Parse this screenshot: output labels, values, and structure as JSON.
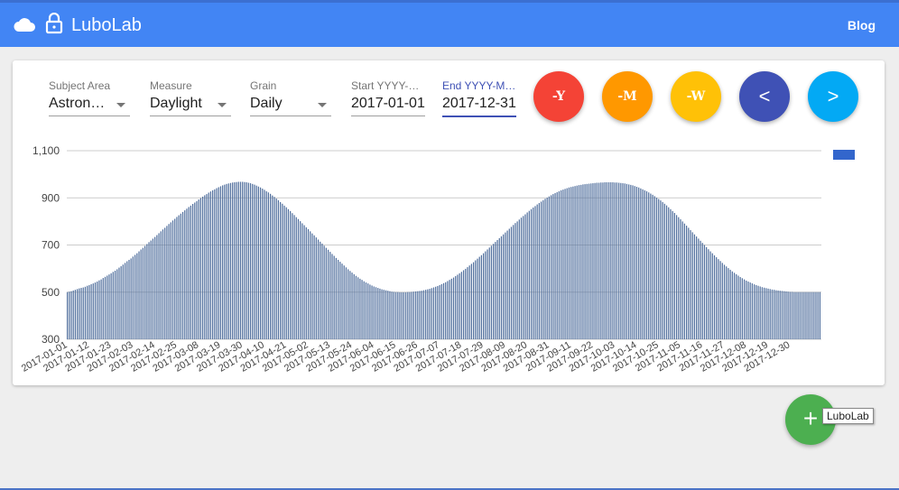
{
  "header": {
    "brand": "LuboLab",
    "blog_link": "Blog",
    "icons": [
      "cloud-icon",
      "lock-icon"
    ],
    "color": "#4285f4"
  },
  "filters": {
    "subject_area": {
      "label": "Subject Area",
      "value": "Astrono..."
    },
    "measure": {
      "label": "Measure",
      "value": "Daylight"
    },
    "grain": {
      "label": "Grain",
      "value": "Daily"
    },
    "start": {
      "label": "Start YYYY-M...",
      "value": "2017-01-01"
    },
    "end": {
      "label": "End YYYY-MM...",
      "value": "2017-12-31"
    }
  },
  "buttons": {
    "minus_year": {
      "label": "-Y",
      "color": "#f44336"
    },
    "minus_month": {
      "label": "-M",
      "color": "#ff9800"
    },
    "minus_week": {
      "label": "-W",
      "color": "#ffc107"
    },
    "prev": {
      "label": "<",
      "color": "#3f51b5"
    },
    "next": {
      "label": ">",
      "color": "#03a9f4"
    },
    "add": {
      "label": "+",
      "color": "#4caf50"
    }
  },
  "tooltip": "LuboLab",
  "chart_data": {
    "type": "bar",
    "title": "",
    "xlabel": "",
    "ylabel": "",
    "ylim": [
      300,
      1100
    ],
    "yticks": [
      "300",
      "500",
      "700",
      "900",
      "1,100"
    ],
    "grid": true,
    "legend": "top-right",
    "series_color": "#4e6d9c",
    "legend_color": "#3366cc",
    "x_start": "2017-01-01",
    "x_end": "2017-12-31",
    "x_tick_labels": [
      "2017-01-01",
      "2017-01-12",
      "2017-01-23",
      "2017-02-03",
      "2017-02-14",
      "2017-02-25",
      "2017-03-08",
      "2017-03-19",
      "2017-03-30",
      "2017-04-10",
      "2017-04-21",
      "2017-05-02",
      "2017-05-13",
      "2017-05-24",
      "2017-06-04",
      "2017-06-15",
      "2017-06-26",
      "2017-07-07",
      "2017-07-18",
      "2017-07-29",
      "2017-08-09",
      "2017-08-20",
      "2017-08-31",
      "2017-09-11",
      "2017-09-22",
      "2017-10-03",
      "2017-10-14",
      "2017-10-25",
      "2017-11-05",
      "2017-11-16",
      "2017-11-27",
      "2017-12-08",
      "2017-12-19",
      "2017-12-30"
    ],
    "values": [
      500,
      502,
      504,
      507,
      510,
      513,
      516,
      518,
      520,
      523,
      527,
      530,
      534,
      537,
      541,
      545,
      550,
      554,
      560,
      565,
      570,
      575,
      580,
      586,
      591,
      597,
      604,
      610,
      617,
      624,
      631,
      637,
      643,
      651,
      658,
      665,
      673,
      681,
      688,
      696,
      704,
      712,
      719,
      727,
      734,
      742,
      750,
      758,
      766,
      773,
      781,
      789,
      796,
      804,
      811,
      819,
      826,
      833,
      840,
      847,
      854,
      861,
      867,
      874,
      880,
      886,
      893,
      899,
      905,
      911,
      916,
      922,
      927,
      932,
      936,
      941,
      945,
      949,
      953,
      956,
      959,
      961,
      963,
      965,
      966,
      967,
      968,
      968,
      968,
      967,
      966,
      964,
      962,
      959,
      956,
      952,
      948,
      944,
      939,
      934,
      928,
      923,
      917,
      910,
      904,
      897,
      890,
      882,
      875,
      867,
      860,
      852,
      844,
      835,
      827,
      818,
      810,
      801,
      792,
      784,
      775,
      767,
      758,
      749,
      741,
      732,
      723,
      714,
      706,
      697,
      688,
      680,
      671,
      662,
      654,
      645,
      637,
      629,
      621,
      613,
      605,
      597,
      590,
      583,
      576,
      569,
      563,
      557,
      552,
      546,
      541,
      537,
      532,
      528,
      524,
      521,
      518,
      515,
      512,
      510,
      508,
      506,
      504,
      502,
      501,
      500,
      500,
      499,
      499,
      499,
      499,
      500,
      500,
      501,
      502,
      503,
      504,
      505,
      506,
      508,
      510,
      512,
      514,
      517,
      520,
      523,
      526,
      530,
      534,
      538,
      542,
      547,
      552,
      557,
      562,
      568,
      574,
      580,
      586,
      593,
      599,
      606,
      613,
      620,
      627,
      635,
      642,
      650,
      657,
      665,
      673,
      681,
      689,
      697,
      705,
      713,
      721,
      729,
      737,
      745,
      753,
      761,
      769,
      777,
      785,
      793,
      800,
      808,
      816,
      823,
      830,
      838,
      845,
      852,
      859,
      865,
      872,
      878,
      884,
      890,
      896,
      901,
      906,
      911,
      916,
      920,
      924,
      928,
      932,
      935,
      938,
      941,
      944,
      946,
      948,
      950,
      952,
      954,
      955,
      957,
      958,
      959,
      960,
      961,
      962,
      963,
      964,
      964,
      965,
      965,
      966,
      966,
      966,
      966,
      966,
      965,
      965,
      964,
      963,
      962,
      961,
      959,
      957,
      955,
      953,
      950,
      947,
      944,
      940,
      936,
      932,
      928,
      923,
      918,
      913,
      907,
      901,
      895,
      889,
      882,
      875,
      868,
      860,
      852,
      844,
      836,
      827,
      818,
      809,
      800,
      791,
      782,
      773,
      763,
      754,
      745,
      736,
      727,
      718,
      709,
      700,
      691,
      682,
      673,
      665,
      656,
      648,
      640,
      632,
      624,
      616,
      609,
      602,
      595,
      588,
      582,
      576,
      570,
      564,
      559,
      554,
      549,
      545,
      541,
      537,
      533,
      530,
      527,
      524,
      521,
      519,
      517,
      515,
      513,
      511,
      510,
      508,
      507,
      506,
      505,
      504,
      503,
      502,
      501,
      501,
      500,
      500,
      500,
      500,
      500,
      500,
      500,
      500,
      500,
      500,
      500,
      500,
      500,
      500
    ]
  }
}
